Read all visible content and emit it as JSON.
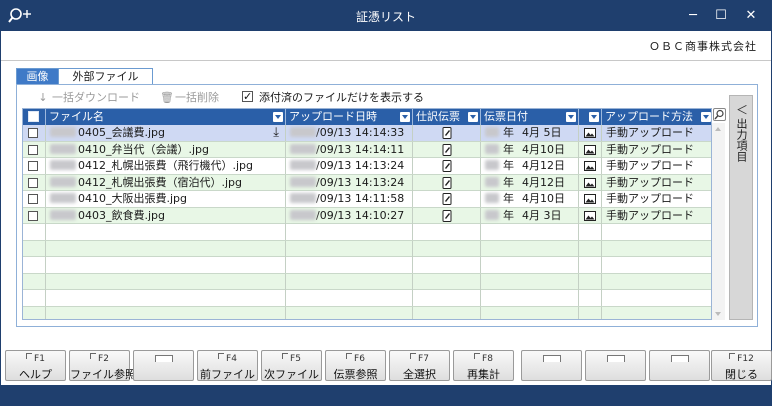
{
  "window": {
    "title": "証憑リスト",
    "minimize": "─",
    "maximize": "☐",
    "close": "✕",
    "search_icon": "search-plus-icon"
  },
  "company": "ＯＢＣ商事株式会社",
  "tabs": [
    {
      "label": "画像",
      "active": false
    },
    {
      "label": "外部ファイル",
      "active": true
    }
  ],
  "toolbar": {
    "bulk_download": "一括ダウンロード",
    "bulk_delete": "一括削除",
    "attached_only": "添付済のファイルだけを表示する",
    "attached_only_checked": true
  },
  "columns": [
    "ファイル名",
    "アップロード日時",
    "仕訳伝票",
    "伝票日付",
    "",
    "アップロード方法"
  ],
  "rows": [
    {
      "file": "0405_会議費.jpg",
      "upload": "/09/13 14:14:33",
      "date_mid": "年",
      "date": "4月 5日",
      "method": "手動アップロード",
      "selected": true,
      "download_icon": true
    },
    {
      "file": "0410_弁当代（会議）.jpg",
      "upload": "/09/13 14:14:11",
      "date_mid": "年",
      "date": "4月10日",
      "method": "手動アップロード",
      "selected": false,
      "download_icon": false
    },
    {
      "file": "0412_札幌出張費（飛行機代）.jpg",
      "upload": "/09/13 14:13:24",
      "date_mid": "年",
      "date": "4月12日",
      "method": "手動アップロード",
      "selected": false,
      "download_icon": false
    },
    {
      "file": "0412_札幌出張費（宿泊代）.jpg",
      "upload": "/09/13 14:13:24",
      "date_mid": "年",
      "date": "4月12日",
      "method": "手動アップロード",
      "selected": false,
      "download_icon": false
    },
    {
      "file": "0410_大阪出張費.jpg",
      "upload": "/09/13 14:11:58",
      "date_mid": "年",
      "date": "4月10日",
      "method": "手動アップロード",
      "selected": false,
      "download_icon": false
    },
    {
      "file": "0403_飲食費.jpg",
      "upload": "/09/13 14:10:27",
      "date_mid": "年",
      "date": "4月 3日",
      "method": "手動アップロード",
      "selected": false,
      "download_icon": false
    }
  ],
  "empty_rows": 6,
  "side_panel": {
    "arrow": "＜",
    "label": "出力項目"
  },
  "fkeys": [
    {
      "num": "F1",
      "label": "ヘルプ"
    },
    {
      "num": "F2",
      "label": "ファイル参照"
    },
    {
      "num": "",
      "label": ""
    },
    {
      "num": "F4",
      "label": "前ファイル"
    },
    {
      "num": "F5",
      "label": "次ファイル"
    },
    {
      "num": "F6",
      "label": "伝票参照"
    },
    {
      "num": "F7",
      "label": "全選択"
    },
    {
      "num": "F8",
      "label": "再集計"
    },
    {
      "num": "",
      "label": ""
    },
    {
      "num": "",
      "label": ""
    },
    {
      "num": "",
      "label": ""
    },
    {
      "num": "F12",
      "label": "閉じる"
    }
  ],
  "colors": {
    "titlebar": "#1f3f6e",
    "header": "#2a5fa8",
    "row_alt": "#e8f7e6",
    "row_selected": "#cfd9f3",
    "tab_active": "#3f7ac7"
  }
}
